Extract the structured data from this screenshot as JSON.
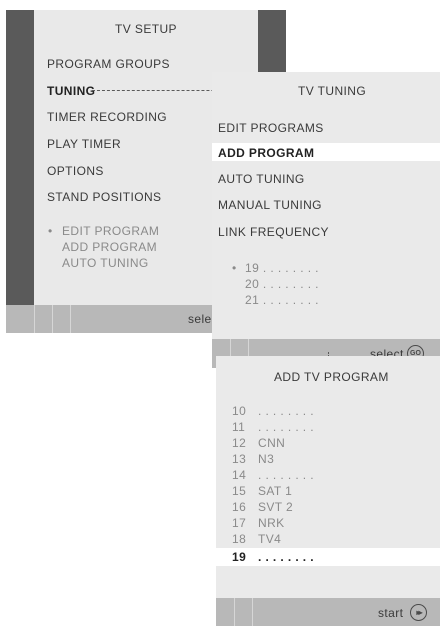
{
  "tv_setup": {
    "title": "TV SETUP",
    "items": [
      "PROGRAM GROUPS",
      "TUNING",
      "TIMER RECORDING",
      "PLAY TIMER",
      "OPTIONS",
      "STAND POSITIONS"
    ],
    "submenu_bullet": "•",
    "submenu": [
      "EDIT PROGRAM",
      "ADD PROGRAM",
      "AUTO TUNING"
    ],
    "footer": "select"
  },
  "tv_tuning": {
    "title": "TV TUNING",
    "items": [
      "EDIT PROGRAMS",
      "ADD PROGRAM",
      "AUTO TUNING",
      "MANUAL TUNING",
      "LINK FREQUENCY"
    ],
    "list_bullet": "•",
    "list": [
      "19 . . . . . . . .",
      "20 . . . . . . . .",
      "21 . . . . . . . ."
    ],
    "footer": "select",
    "footer_icon": "GO"
  },
  "add_tv_program": {
    "title": "ADD TV PROGRAM",
    "rows": [
      {
        "num": "10",
        "name": ". . . . . . . ."
      },
      {
        "num": "11",
        "name": ". . . . . . . ."
      },
      {
        "num": "12",
        "name": "CNN"
      },
      {
        "num": "13",
        "name": "N3"
      },
      {
        "num": "14",
        "name": ". . . . . . . ."
      },
      {
        "num": "15",
        "name": "SAT 1"
      },
      {
        "num": "16",
        "name": "SVT 2"
      },
      {
        "num": "17",
        "name": "NRK"
      },
      {
        "num": "18",
        "name": "TV4"
      },
      {
        "num": "19",
        "name": ". . . . . . . ."
      }
    ],
    "footer": "start",
    "footer_icon": "▸▸"
  },
  "colors": {
    "dark_frame": "#5a5a5a",
    "panel_bg": "#eaeaea",
    "footer_bar": "#b8b8b8",
    "highlight": "#ffffff"
  }
}
